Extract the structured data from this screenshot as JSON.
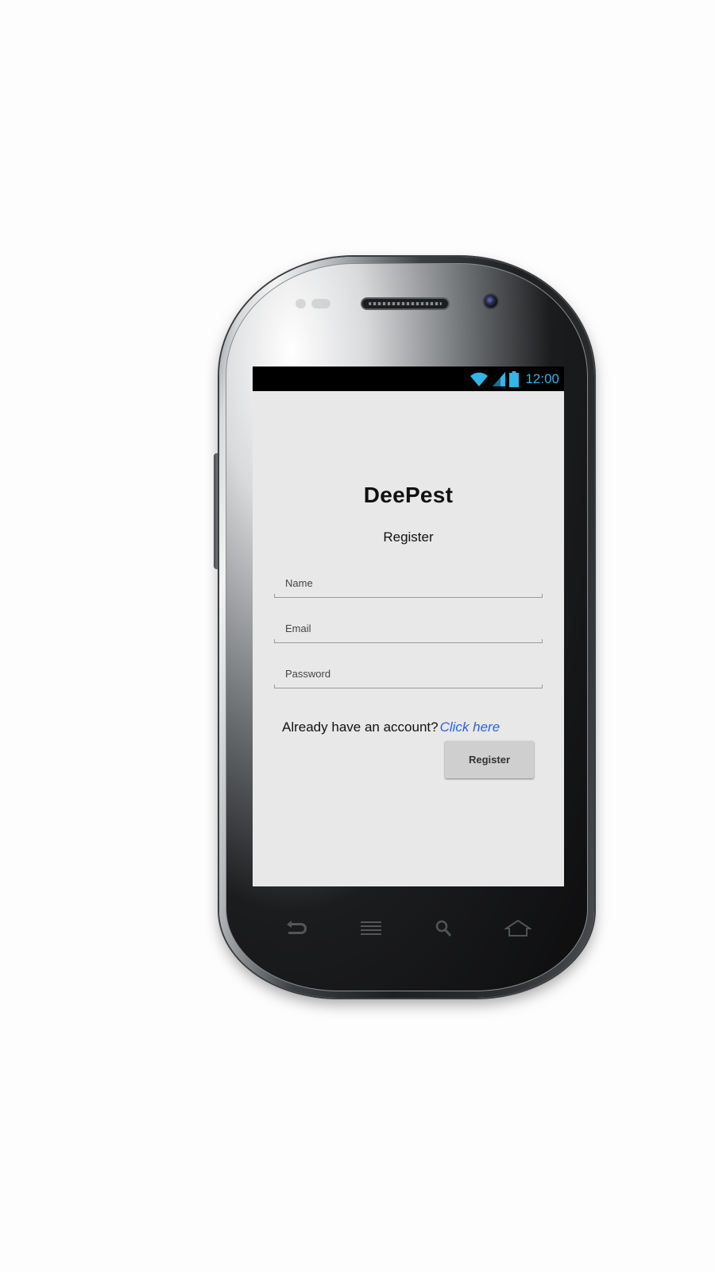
{
  "status_bar": {
    "time": "12:00",
    "icons": [
      "wifi-icon",
      "signal-icon",
      "battery-icon"
    ],
    "accent_color": "#33b5e5"
  },
  "app": {
    "title": "DeePest",
    "subtitle": "Register"
  },
  "form": {
    "name": {
      "placeholder": "Name",
      "value": ""
    },
    "email": {
      "placeholder": "Email",
      "value": ""
    },
    "password": {
      "placeholder": "Password",
      "value": ""
    }
  },
  "login_prompt": {
    "text": "Already have an account?",
    "link_label": "Click here",
    "link_color": "#2b62d9"
  },
  "actions": {
    "register_label": "Register"
  },
  "device_nav": {
    "keys": [
      "back-icon",
      "menu-icon",
      "search-icon",
      "home-icon"
    ]
  }
}
